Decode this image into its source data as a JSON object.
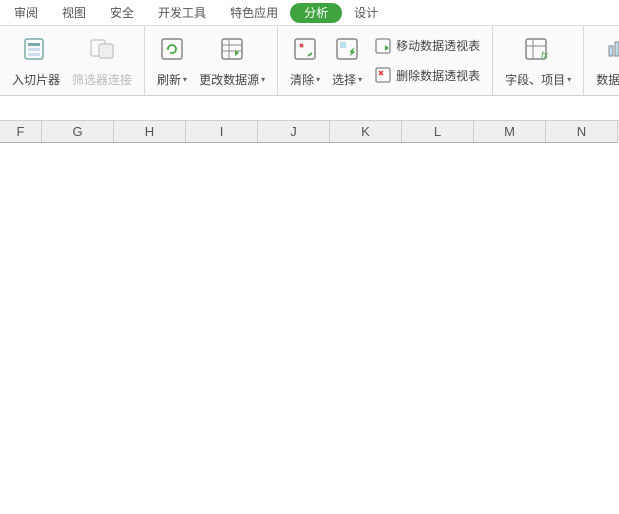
{
  "tabs": {
    "review": "审阅",
    "view": "视图",
    "security": "安全",
    "devtools": "开发工具",
    "special": "特色应用",
    "analysis": "分析",
    "design": "设计"
  },
  "ribbon": {
    "insert_slicer": "入切片器",
    "filter_conn": "筛选器连接",
    "refresh": "刷新",
    "change_source": "更改数据源",
    "clear": "清除",
    "select": "选择",
    "move_pivot": "移动数据透视表",
    "delete_pivot": "删除数据透视表",
    "fields_items": "字段、项目",
    "pivot_view": "数据透视"
  },
  "columns": [
    "F",
    "G",
    "H",
    "I",
    "J",
    "K",
    "L",
    "M",
    "N"
  ],
  "colors": {
    "accent": "#3fa33f",
    "icon_green": "#4aa84a",
    "icon_red": "#d44"
  }
}
